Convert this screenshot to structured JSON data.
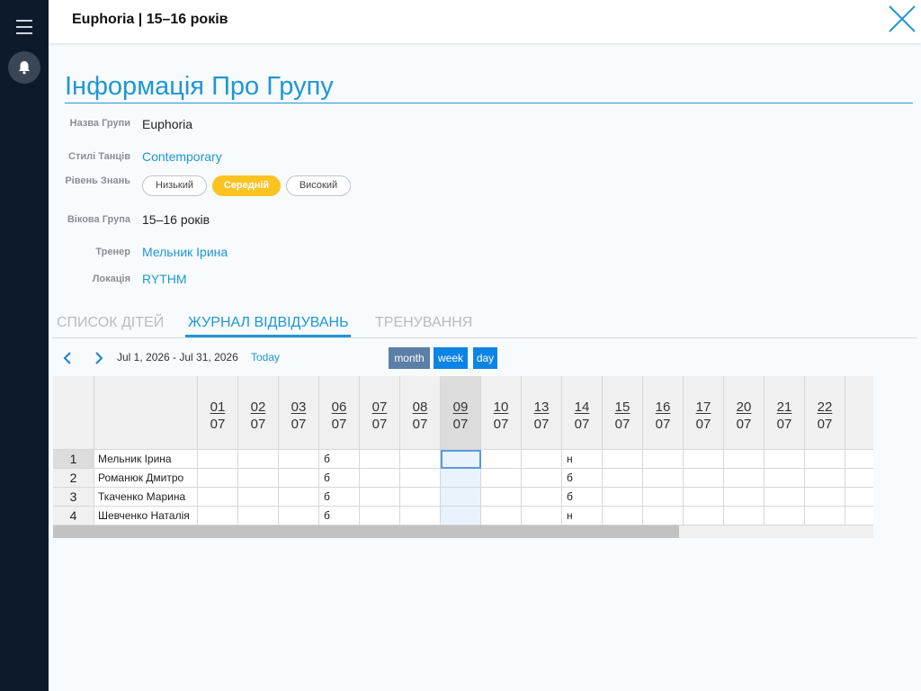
{
  "header": {
    "title": "Euphoria | 15–16 років"
  },
  "section": {
    "title": "Інформація Про Групу"
  },
  "info": {
    "group_name_label": "Назва Групи",
    "group_name": "Euphoria",
    "styles_label": "Стилі Танців",
    "styles": "Contemporary",
    "level_label": "Рівень Знань",
    "levels": [
      {
        "label": "Низький",
        "active": false
      },
      {
        "label": "Середній",
        "active": true
      },
      {
        "label": "Високий",
        "active": false
      }
    ],
    "age_label": "Вікова Група",
    "age": "15–16 років",
    "trainer_label": "Тренер",
    "trainer": "Мельник Ірина",
    "location_label": "Локація",
    "location": "RYTHM"
  },
  "tabs": [
    {
      "label": "СПИСОК ДІТЕЙ",
      "active": false
    },
    {
      "label": "ЖУРНАЛ ВІДВІДУВАНЬ",
      "active": true
    },
    {
      "label": "ТРЕНУВАННЯ",
      "active": false
    }
  ],
  "calendar": {
    "date_range": "Jul 1, 2026 - Jul 31, 2026",
    "today_label": "Today",
    "views": {
      "month": "month",
      "week": "week",
      "day": "day"
    },
    "dates": [
      {
        "day": "01",
        "month": "07"
      },
      {
        "day": "02",
        "month": "07"
      },
      {
        "day": "03",
        "month": "07"
      },
      {
        "day": "06",
        "month": "07"
      },
      {
        "day": "07",
        "month": "07"
      },
      {
        "day": "08",
        "month": "07"
      },
      {
        "day": "09",
        "month": "07"
      },
      {
        "day": "10",
        "month": "07"
      },
      {
        "day": "13",
        "month": "07"
      },
      {
        "day": "14",
        "month": "07"
      },
      {
        "day": "15",
        "month": "07"
      },
      {
        "day": "16",
        "month": "07"
      },
      {
        "day": "17",
        "month": "07"
      },
      {
        "day": "20",
        "month": "07"
      },
      {
        "day": "21",
        "month": "07"
      },
      {
        "day": "22",
        "month": "07"
      }
    ],
    "selected_date_index": 6,
    "rows": [
      {
        "num": "1",
        "name": "Мельник Ірина",
        "marks": [
          "",
          "",
          "",
          "б",
          "",
          "",
          "",
          "",
          "",
          "н",
          "",
          "",
          "",
          "",
          "",
          ""
        ]
      },
      {
        "num": "2",
        "name": "Романюк Дмитро",
        "marks": [
          "",
          "",
          "",
          "б",
          "",
          "",
          "",
          "",
          "",
          "б",
          "",
          "",
          "",
          "",
          "",
          ""
        ]
      },
      {
        "num": "3",
        "name": "Ткаченко Марина",
        "marks": [
          "",
          "",
          "",
          "б",
          "",
          "",
          "",
          "",
          "",
          "б",
          "",
          "",
          "",
          "",
          "",
          ""
        ]
      },
      {
        "num": "4",
        "name": "Шевченко Наталія",
        "marks": [
          "",
          "",
          "",
          "б",
          "",
          "",
          "",
          "",
          "",
          "н",
          "",
          "",
          "",
          "",
          "",
          ""
        ]
      }
    ]
  },
  "icons": {
    "menu": "menu-icon",
    "bell": "bell-icon",
    "close": "close-icon",
    "prev": "chevron-left-icon",
    "next": "chevron-right-icon"
  },
  "colors": {
    "accent": "#2196d3",
    "active_level": "#f9c322",
    "sidebar": "#0d1a2b"
  }
}
